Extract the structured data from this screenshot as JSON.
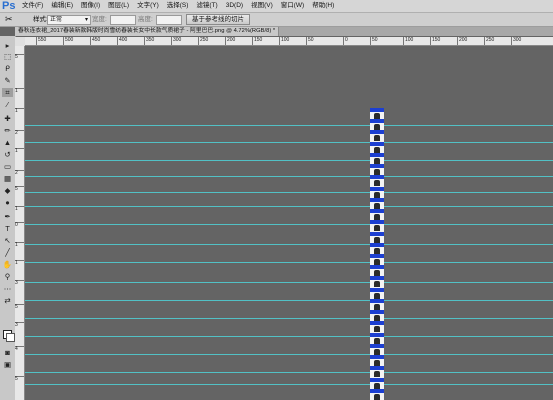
{
  "app": {
    "logo": "Ps"
  },
  "menu": [
    "文件(F)",
    "编辑(E)",
    "图像(I)",
    "图层(L)",
    "文字(Y)",
    "选择(S)",
    "滤镜(T)",
    "3D(D)",
    "视图(V)",
    "窗口(W)",
    "帮助(H)"
  ],
  "options": {
    "style_label": "样式:",
    "style_value": "正常",
    "width_label": "宽度:",
    "height_label": "高度:",
    "slice_button": "基于参考线的切片"
  },
  "document": {
    "tab_title": "春秋连衣裙_2017春装新款韩版时尚雪纺春装长女中长款气质裙子 - 阿里巴巴.png @ 4.72%(RGB/8) *"
  },
  "ruler_top": [
    "550",
    "500",
    "450",
    "400",
    "350",
    "300",
    "250",
    "200",
    "150",
    "100",
    "50",
    "0",
    "50",
    "100",
    "150",
    "200",
    "250",
    "300"
  ],
  "ruler_left": [
    "5",
    "1",
    "1",
    "2",
    "1",
    "2",
    "5",
    "1",
    "0",
    "1",
    "1",
    "3",
    "5",
    "3",
    "4",
    "5"
  ],
  "tools": [
    "move-icon",
    "marquee-icon",
    "lasso-icon",
    "quick-select-icon",
    "crop-icon",
    "eyedropper-icon",
    "healing-icon",
    "brush-icon",
    "stamp-icon",
    "history-brush-icon",
    "eraser-icon",
    "gradient-icon",
    "blur-icon",
    "dodge-icon",
    "pen-icon",
    "type-icon",
    "path-select-icon",
    "shape-icon",
    "hand-icon",
    "zoom-icon"
  ],
  "strip": {
    "tag_text": "06 05",
    "count": 26
  }
}
